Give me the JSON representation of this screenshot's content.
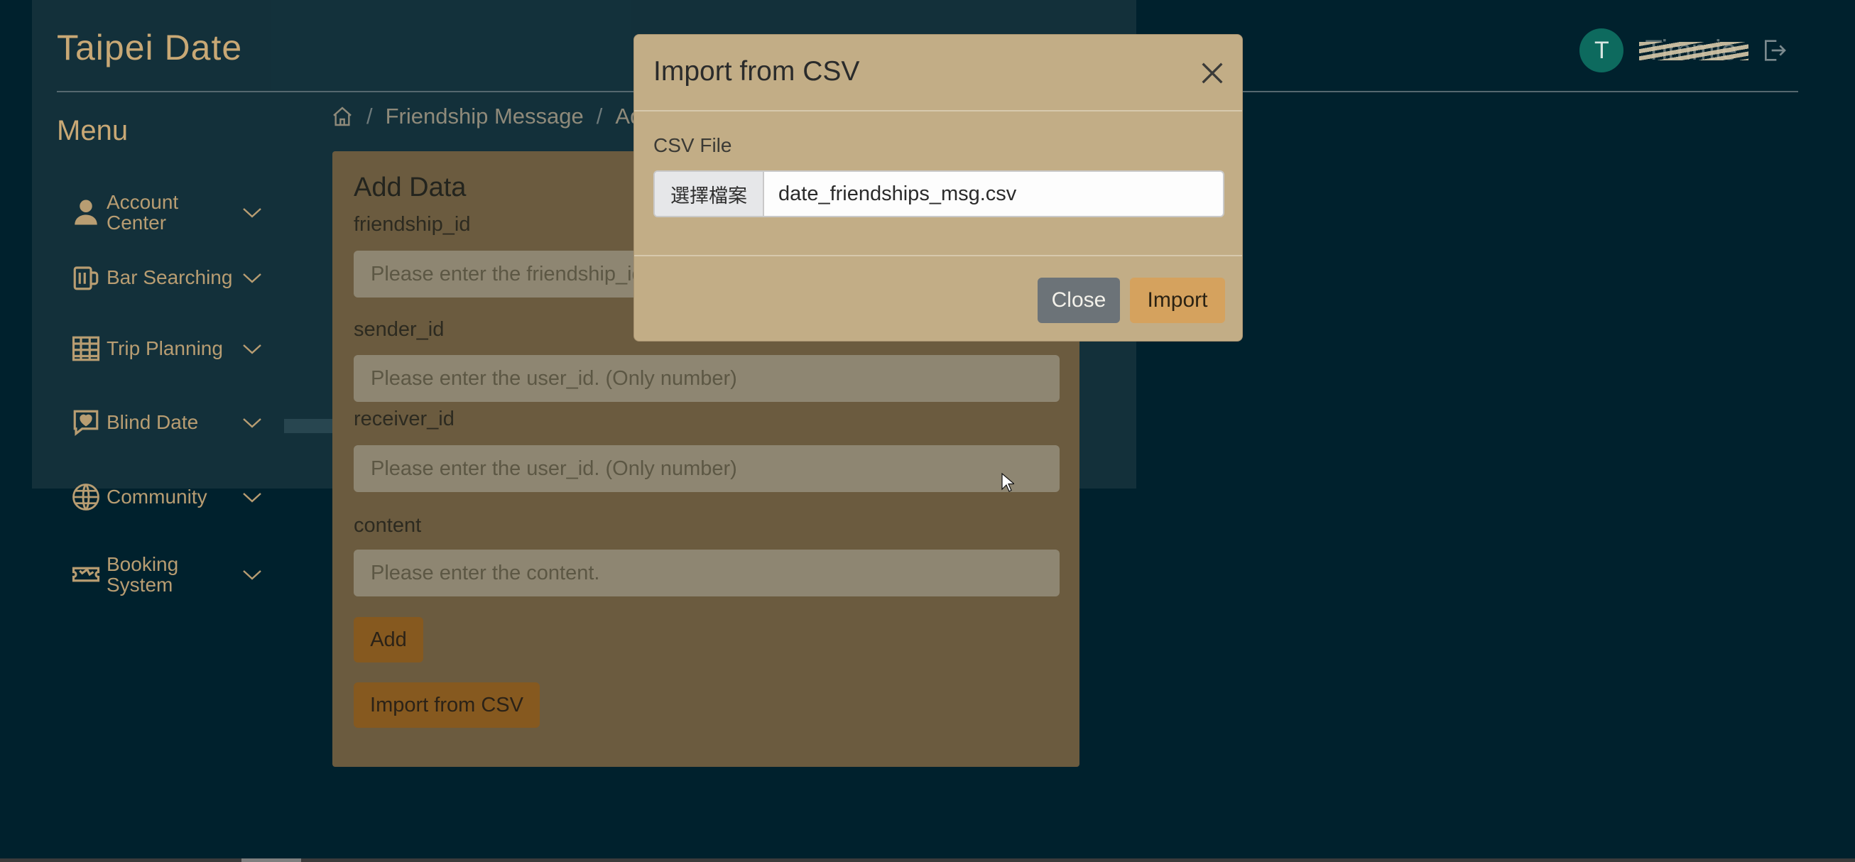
{
  "app": {
    "brand": "Taipei Date",
    "avatar_initial": "T",
    "username": "Timmie"
  },
  "sidebar": {
    "menu_title": "Menu",
    "items": [
      {
        "label": "Account Center",
        "icon": "user-icon"
      },
      {
        "label": "Bar Searching",
        "icon": "beer-mug-icon"
      },
      {
        "label": "Trip Planning",
        "icon": "table-grid-icon"
      },
      {
        "label": "Blind Date",
        "icon": "heart-chat-icon"
      },
      {
        "label": "Community",
        "icon": "globe-icon"
      },
      {
        "label": "Booking System",
        "icon": "ticket-icon"
      }
    ]
  },
  "breadcrumb": {
    "items": [
      "Friendship Message",
      "Add"
    ]
  },
  "form": {
    "title": "Add Data",
    "fields": [
      {
        "label": "friendship_id",
        "placeholder": "Please enter the friendship_id."
      },
      {
        "label": "sender_id",
        "placeholder": "Please enter the user_id. (Only number)"
      },
      {
        "label": "receiver_id",
        "placeholder": "Please enter the user_id. (Only number)"
      },
      {
        "label": "content",
        "placeholder": "Please enter the content."
      }
    ],
    "add_button": "Add",
    "import_button": "Import from CSV"
  },
  "modal": {
    "title": "Import from CSV",
    "file_label": "CSV File",
    "file_button": "選擇檔案",
    "file_name": "date_friendships_msg.csv",
    "close_button": "Close",
    "import_button": "Import"
  },
  "colors": {
    "background": "#00212d",
    "accent": "#c8a875",
    "modal_bg": "#c2ad86",
    "import_btn": "#d5a25e",
    "close_btn": "#6c7378"
  }
}
